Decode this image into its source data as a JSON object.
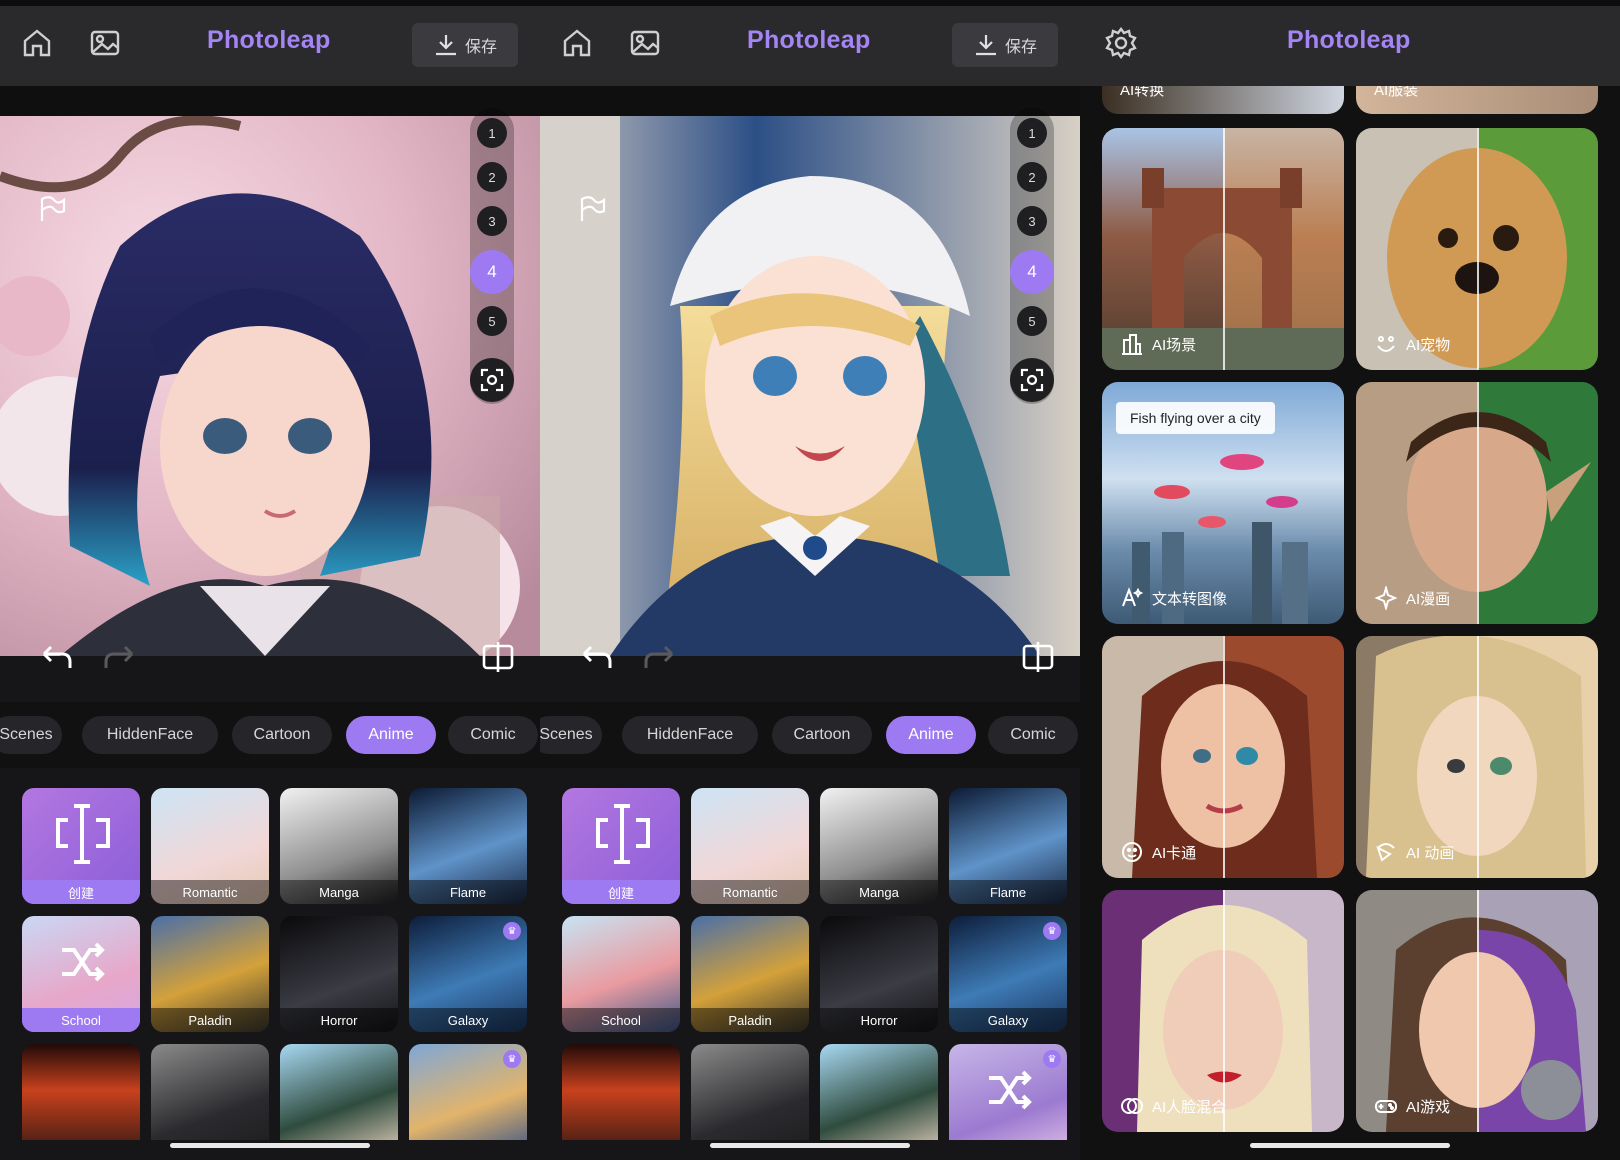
{
  "colors": {
    "accent": "#9d7af2",
    "topbar": "#2a2a2d",
    "background": "#161618"
  },
  "app": {
    "title": "Photoleap",
    "save_label": "保存"
  },
  "editor": {
    "steps": [
      "1",
      "2",
      "3",
      "4",
      "5"
    ],
    "active_step": "4"
  },
  "tabs": [
    "Scenes",
    "HiddenFace",
    "Cartoon",
    "Anime",
    "Comic"
  ],
  "active_tab": "Anime",
  "panel1": {
    "styles": [
      {
        "label": "创建",
        "kind": "create"
      },
      {
        "label": "Romantic"
      },
      {
        "label": "Manga"
      },
      {
        "label": "Flame"
      },
      {
        "label": "School",
        "selected": true
      },
      {
        "label": "Paladin"
      },
      {
        "label": "Horror"
      },
      {
        "label": "Galaxy",
        "premium": true
      },
      {
        "label": ""
      },
      {
        "label": ""
      },
      {
        "label": ""
      },
      {
        "label": "",
        "premium": true
      }
    ]
  },
  "panel2": {
    "styles": [
      {
        "label": "创建",
        "kind": "create"
      },
      {
        "label": "Romantic"
      },
      {
        "label": "Manga"
      },
      {
        "label": "Flame"
      },
      {
        "label": "School"
      },
      {
        "label": "Paladin"
      },
      {
        "label": "Horror"
      },
      {
        "label": "Galaxy",
        "premium": true
      },
      {
        "label": ""
      },
      {
        "label": ""
      },
      {
        "label": ""
      },
      {
        "label": "",
        "premium": true,
        "shuffle": true
      }
    ]
  },
  "features": {
    "top_partial": [
      "AI转换",
      "AI服装"
    ],
    "cards": [
      {
        "label": "AI场景",
        "icon": "city-icon"
      },
      {
        "label": "AI宠物",
        "icon": "pet-icon"
      },
      {
        "label": "文本转图像",
        "icon": "text-to-image-icon",
        "prompt": "Fish flying over a city"
      },
      {
        "label": "AI漫画",
        "icon": "sparkle-icon"
      },
      {
        "label": "AI卡通",
        "icon": "cartoon-icon"
      },
      {
        "label": "AI 动画",
        "icon": "animation-icon"
      },
      {
        "label": "AI人脸混合",
        "icon": "face-mix-icon"
      },
      {
        "label": "AI游戏",
        "icon": "gamepad-icon"
      }
    ]
  }
}
